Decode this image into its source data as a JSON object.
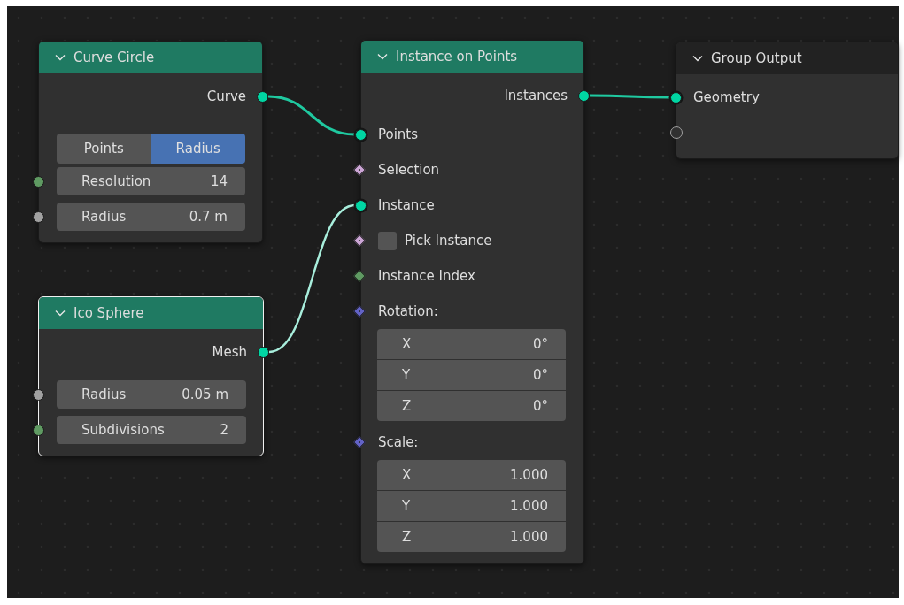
{
  "nodes": [
    {
      "title": "Curve Circle",
      "kind": "geometry",
      "selected": false,
      "rows": [
        {
          "kind": "output",
          "label": "Curve",
          "socket": {
            "kind": "circle",
            "color": "#00d6a3"
          },
          "link": {
            "highlighted": false
          }
        },
        {
          "kind": "enum",
          "options": [
            {
              "label": "Points",
              "selected": false
            },
            {
              "label": "Radius",
              "selected": true
            }
          ]
        },
        {
          "kind": "field",
          "label": "Resolution",
          "value": "14",
          "socket": {
            "kind": "circle",
            "color": "#5f9a62"
          }
        },
        {
          "kind": "field",
          "label": "Radius",
          "value": "0.7 m",
          "socket": {
            "kind": "circle",
            "color": "#a1a1a1"
          }
        }
      ]
    },
    {
      "title": "Ico Sphere",
      "kind": "geometry",
      "selected": true,
      "rows": [
        {
          "kind": "output",
          "label": "Mesh",
          "socket": {
            "kind": "circle",
            "color": "#00d6a3"
          },
          "link": {
            "highlighted": true
          }
        },
        {
          "kind": "field",
          "label": "Radius",
          "value": "0.05 m",
          "socket": {
            "kind": "circle",
            "color": "#a1a1a1"
          }
        },
        {
          "kind": "field",
          "label": "Subdivisions",
          "value": "2",
          "socket": {
            "kind": "circle",
            "color": "#5f9a62"
          }
        }
      ]
    },
    {
      "title": "Instance on Points",
      "kind": "geometry",
      "selected": false,
      "rows": [
        {
          "kind": "output",
          "label": "Instances",
          "socket": {
            "kind": "circle",
            "color": "#00d6a3"
          },
          "link": {
            "highlighted": false
          }
        },
        {
          "kind": "input",
          "label": "Points",
          "linked": true,
          "socket": {
            "kind": "circle",
            "color": "#00d6a3"
          }
        },
        {
          "kind": "input",
          "label": "Selection",
          "linked": false,
          "socket": {
            "kind": "diamond_dot",
            "color": "#cca6d6"
          }
        },
        {
          "kind": "input",
          "label": "Instance",
          "linked": true,
          "socket": {
            "kind": "circle",
            "color": "#00d6a3"
          }
        },
        {
          "kind": "checkbox",
          "label": "Pick Instance",
          "checked": false,
          "socket": {
            "kind": "diamond_dot",
            "color": "#cca6d6"
          }
        },
        {
          "kind": "input",
          "label": "Instance Index",
          "linked": false,
          "socket": {
            "kind": "diamond",
            "color": "#5f9a62"
          }
        },
        {
          "kind": "input",
          "label": "Rotation:",
          "linked": false,
          "socket": {
            "kind": "diamond_dot",
            "color": "#6363c7"
          }
        },
        {
          "kind": "vector",
          "components": [
            {
              "axis": "X",
              "value": "0°"
            },
            {
              "axis": "Y",
              "value": "0°"
            },
            {
              "axis": "Z",
              "value": "0°"
            }
          ]
        },
        {
          "kind": "input",
          "label": "Scale:",
          "linked": false,
          "socket": {
            "kind": "diamond_dot",
            "color": "#6363c7"
          }
        },
        {
          "kind": "vector",
          "components": [
            {
              "axis": "X",
              "value": "1.000"
            },
            {
              "axis": "Y",
              "value": "1.000"
            },
            {
              "axis": "Z",
              "value": "1.000"
            }
          ]
        }
      ]
    },
    {
      "title": "Group Output",
      "kind": "group_output",
      "selected": false,
      "rows": [
        {
          "kind": "input",
          "label": "Geometry",
          "linked": true,
          "socket": {
            "kind": "circle",
            "color": "#00d6a3"
          }
        },
        {
          "kind": "input",
          "linked": false,
          "socket": {
            "kind": "hollow",
            "color": "#a1a1a1"
          }
        }
      ]
    }
  ]
}
